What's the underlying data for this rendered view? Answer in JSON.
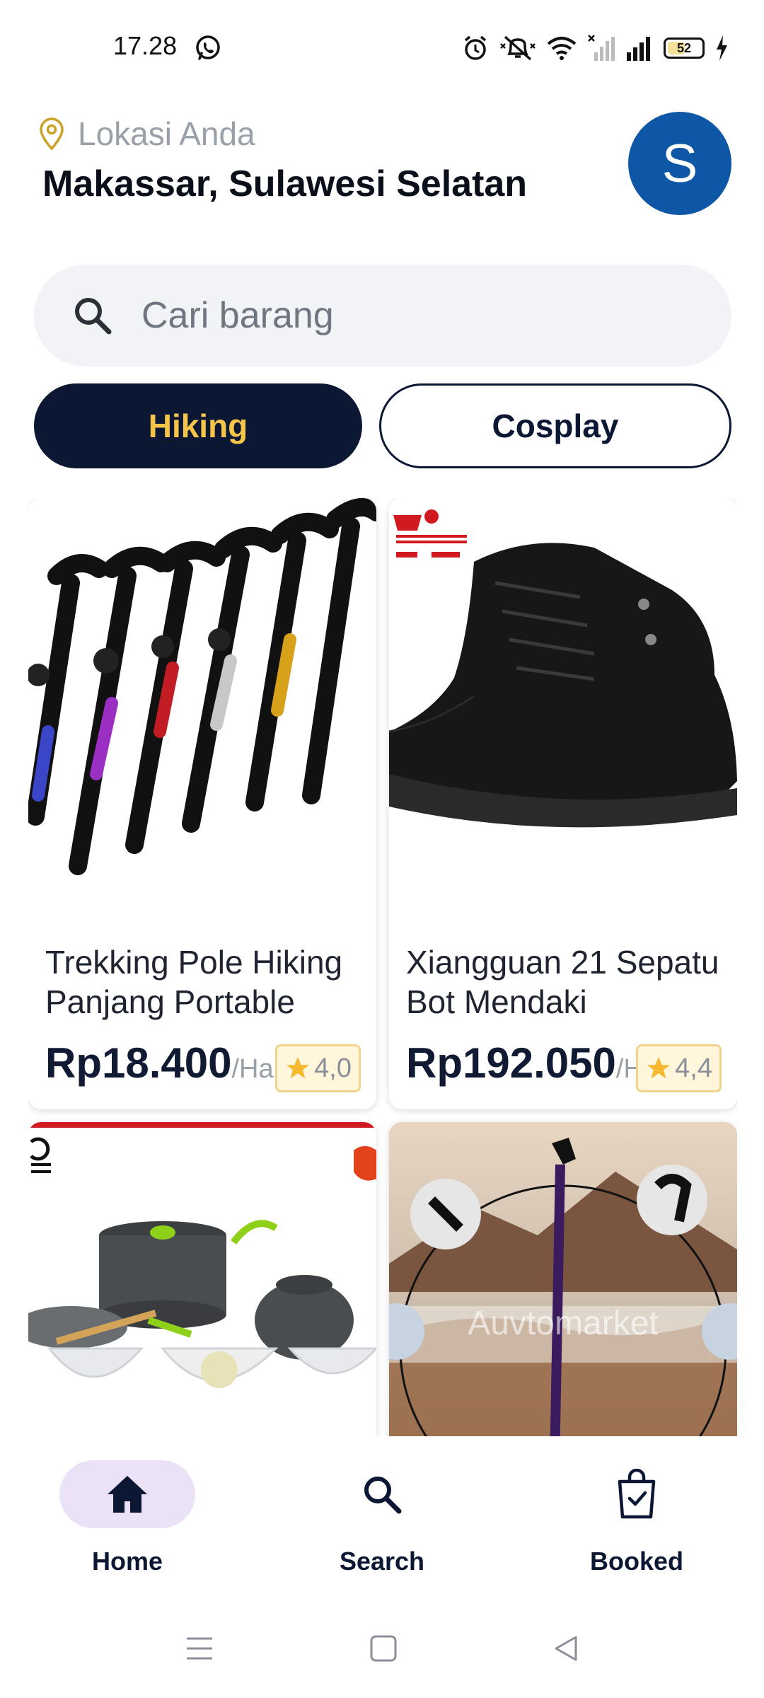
{
  "status_bar": {
    "time": "17.28",
    "battery_level": "52",
    "battery_fraction": 0.52
  },
  "header": {
    "location_label": "Lokasi Anda",
    "location_city": "Makassar, Sulawesi Selatan",
    "avatar_initial": "S",
    "avatar_color": "#0d57a6"
  },
  "search": {
    "placeholder": "Cari barang"
  },
  "categories": [
    {
      "label": "Hiking",
      "selected": true
    },
    {
      "label": "Cosplay",
      "selected": false
    }
  ],
  "products": [
    {
      "title": "Trekking Pole Hiking Panjang Portable",
      "price": "Rp18.400",
      "unit": "/Hari",
      "rating": "4,0"
    },
    {
      "title": "Xiangguan 21 Sepatu Bot Mendaki",
      "price": "Rp192.050",
      "unit": "/Hari",
      "rating": "4,4"
    },
    {
      "image_text": "Auvtomarket"
    }
  ],
  "bottom_nav": [
    {
      "label": "Home",
      "icon": "home-icon",
      "active": true
    },
    {
      "label": "Search",
      "icon": "search-icon",
      "active": false
    },
    {
      "label": "Booked",
      "icon": "shopping-bag-check-icon",
      "active": false
    }
  ],
  "colors": {
    "primary_dark": "#0c1733",
    "accent_yellow": "#f5c54a",
    "active_nav_bg": "#ebe2f8"
  }
}
